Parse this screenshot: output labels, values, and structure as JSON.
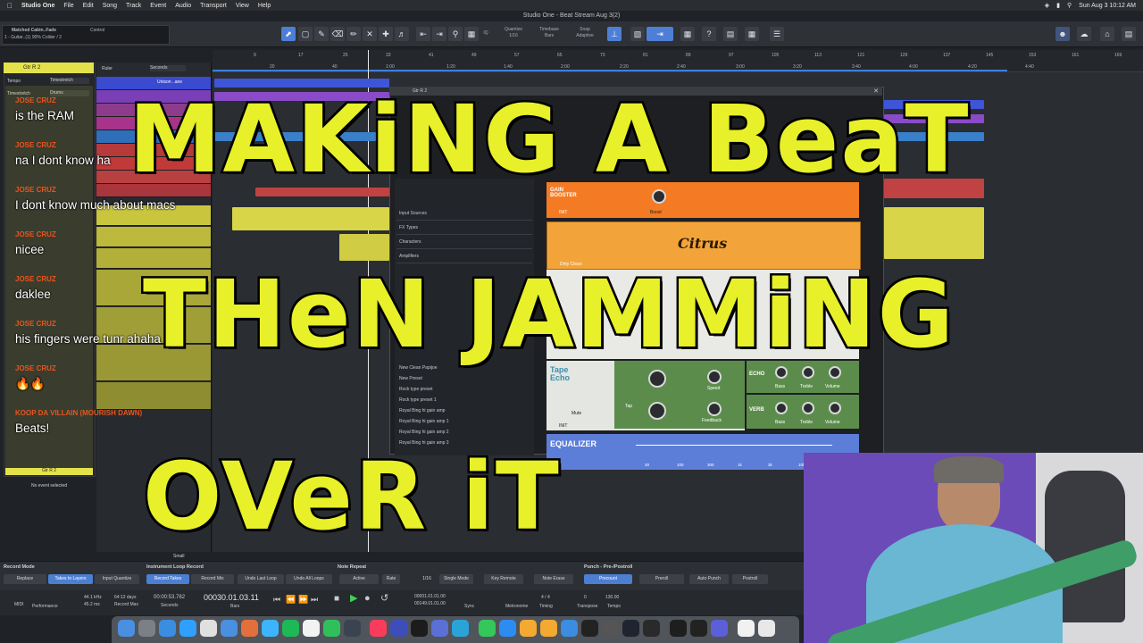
{
  "menubar": {
    "app": "Studio One",
    "items": [
      "File",
      "Edit",
      "Song",
      "Track",
      "Event",
      "Audio",
      "Transport",
      "View",
      "Help"
    ],
    "clock": "Sun Aug 3  10:12 AM"
  },
  "window_title": "Studio One - Beat Stream Aug 3(2)",
  "song_info": {
    "name": "Matched Cabin..Fade",
    "sub": "1 - Guitar..(1)  90% Colder  / 2",
    "control": "Control"
  },
  "toolbar": {
    "quantize_label": "Quantize",
    "quantize_value": "1/16",
    "timebase_label": "Timebase",
    "timebase_value": "Bars",
    "snap_label": "Snap",
    "snap_value": "Adaptive",
    "iq": "IQ"
  },
  "inspector": {
    "track_name": "Gtr R 2",
    "tempo_label": "Tempo",
    "tempo_value": "Timestretch",
    "timestretch_label": "Timestretch",
    "timestretch_value": "Drums",
    "footer": "Gtr R 2",
    "no_event": "No event selected"
  },
  "tracklist": {
    "ruler_label": "Ruler",
    "ruler_value": "Seconds",
    "first_track": "Unison ..ane",
    "bottom_small": "Small"
  },
  "ruler": {
    "bars": [
      "9",
      "17",
      "25",
      "33",
      "41",
      "49",
      "57",
      "65",
      "73",
      "81",
      "89",
      "97",
      "105",
      "113",
      "121",
      "129",
      "137",
      "145",
      "153",
      "161",
      "169"
    ],
    "times": [
      "20",
      "40",
      "1:00",
      "1:20",
      "1:40",
      "2:00",
      "2:20",
      "2:40",
      "3:00",
      "3:20",
      "3:40",
      "4:00",
      "4:20",
      "4:40"
    ]
  },
  "plugin": {
    "title": "Gtr R 2",
    "browser_sections": [
      "Input Sources",
      "FX Types",
      "Characters",
      "Amplifiers"
    ],
    "presets": [
      "New Clean Papijoe",
      "New Preset",
      "Rock type preset",
      "Rock type preset 1",
      "Royal Bing hi gain amp",
      "Royal Bing hi gain amp 1",
      "Royal Bing hi gain amp 2",
      "Royal Bing hi gain amp 3"
    ],
    "gain_booster": "GAIN BOOSTER",
    "boost_label": "Boost",
    "init": "INIT",
    "citrus": "Citrus",
    "dirty_clean": "Dirty Clean",
    "tape_echo": "Tape Echo",
    "tap": "Tap",
    "mute": "Mute",
    "speed": "Speed",
    "feedback": "Feedback",
    "echo": "ECHO",
    "verb": "VERB",
    "bass": "Bass",
    "treble": "Treble",
    "volume": "Volume",
    "equalizer": "EQUALIZER",
    "eq_freqs": [
      "30",
      "100",
      "300",
      "1k",
      "3k",
      "10k"
    ]
  },
  "bottom": {
    "record_mode": "Record Mode",
    "replace": "Replace",
    "takes_to_layers": "Takes to Layers",
    "input_quantize": "Input Quantize",
    "instrument_loop_record": "Instrument Loop Record",
    "record_takes": "Record Takes",
    "record_mix": "Record Mix",
    "undo_last_loop": "Undo Last Loop",
    "undo_all_loops": "Undo All Loops",
    "note_repeat": "Note Repeat",
    "active": "Active",
    "rate": "Rate",
    "rate_value": "1/16",
    "single_mode": "Single Mode",
    "key_remote": "Key Remote",
    "note_erase": "Note Erase",
    "punch": "Punch - Pre-/Postroll",
    "precount": "Precount",
    "preroll": "Preroll",
    "auto_punch": "Auto Punch",
    "postroll": "Postroll"
  },
  "transport": {
    "sample_rate": "44.1 kHz",
    "sample_sub": "45.2 ms",
    "record_max_value": "64:12 days",
    "record_max": "Record Max",
    "seconds_value": "00:00:53.782",
    "seconds": "Seconds",
    "position": "00030.01.03.11",
    "bars": "Bars",
    "loop_start": "00001.01.01.00",
    "loop_end": "00149.01.01.00",
    "metronome": "Metronome",
    "timing_value": "4 / 4",
    "timing": "Timing",
    "transpose_value": "0",
    "transpose": "Transpose",
    "tempo_value": "130.00",
    "tempo": "Tempo",
    "midi": "MIDI",
    "performance": "Performance",
    "sync": "Sync"
  },
  "chat": [
    {
      "name": "JOSE CRUZ",
      "msg": "is the RAM"
    },
    {
      "name": "JOSE CRUZ",
      "msg": "na I dont know ha"
    },
    {
      "name": "JOSE CRUZ",
      "msg": "I dont know much about macs"
    },
    {
      "name": "JOSE CRUZ",
      "msg": "nicee"
    },
    {
      "name": "JOSE CRUZ",
      "msg": "daklee"
    },
    {
      "name": "JOSE CRUZ",
      "msg": "his fingers were tunr ahaha"
    },
    {
      "name": "JOSE CRUZ",
      "msg": "🔥🔥"
    },
    {
      "name": "KOOP DA VILLAIN (MOURISH DAWN)",
      "msg": "Beats!"
    }
  ],
  "headline": {
    "line1": "MAKiNG A BeaT",
    "line2": "THeN JAMMiNG",
    "line3": "OVeR iT"
  },
  "colors": {
    "headline": "#e8f02a",
    "chat_name": "#e8541f",
    "accent_blue": "#4c7fd2",
    "track_yellow": "#e4e24a"
  }
}
